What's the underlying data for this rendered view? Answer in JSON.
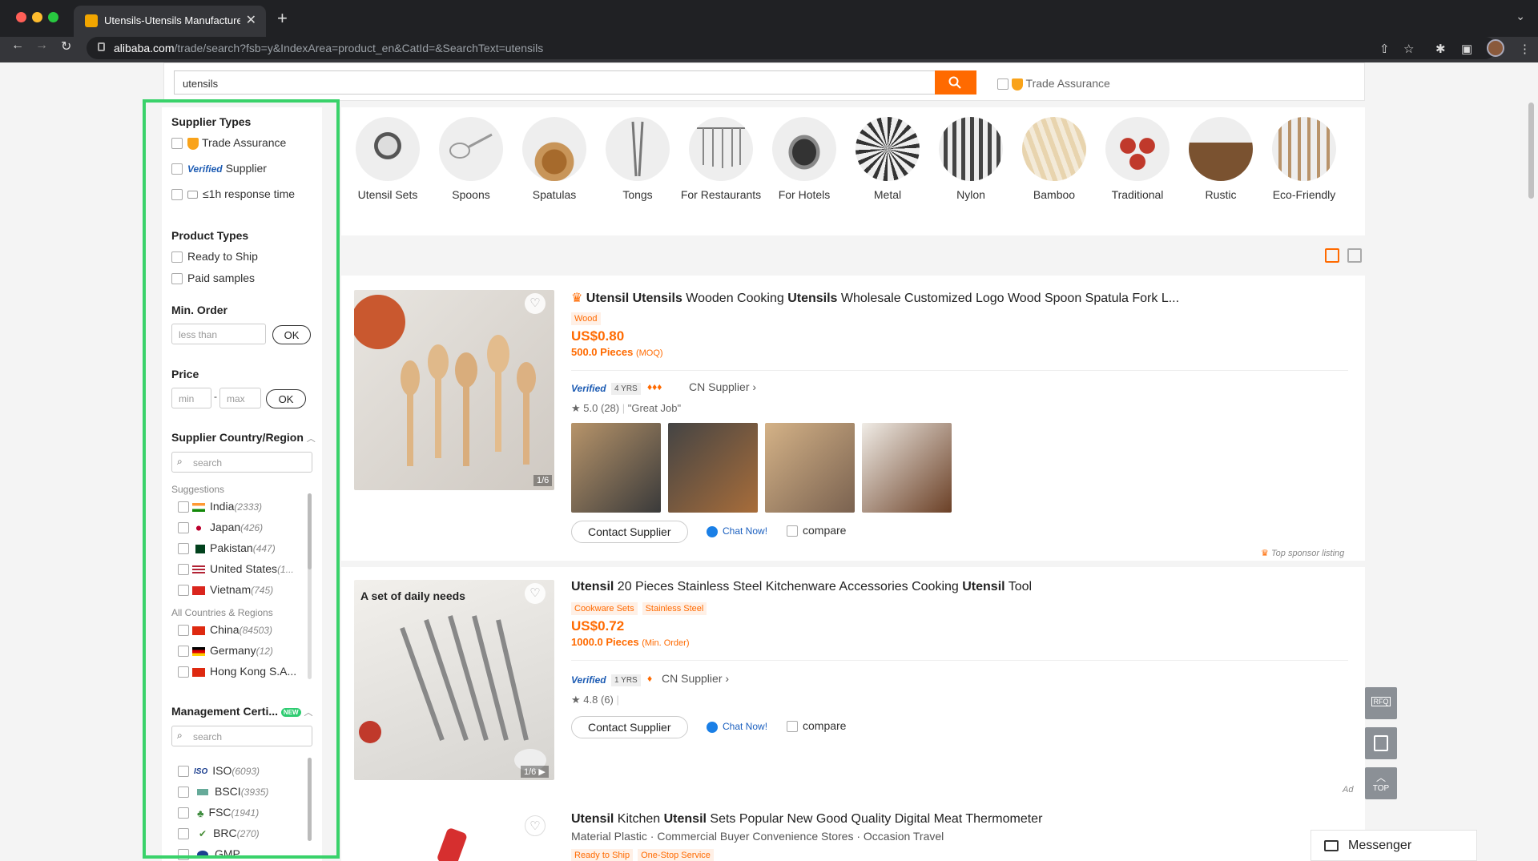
{
  "browser": {
    "tab_title": "Utensils-Utensils Manufacturer",
    "url_domain": "alibaba.com",
    "url_path": "/trade/search?fsb=y&IndexArea=product_en&CatId=&SearchText=utensils"
  },
  "search": {
    "value": "utensils",
    "trade_assurance": "Trade Assurance"
  },
  "filters": {
    "supplier_types_title": "Supplier Types",
    "trade_assurance": "Trade Assurance",
    "verified": "Verified",
    "supplier": "Supplier",
    "response_time": "≤1h response time",
    "product_types_title": "Product Types",
    "ready_to_ship": "Ready to Ship",
    "paid_samples": "Paid samples",
    "min_order_title": "Min. Order",
    "min_order_placeholder": "less than",
    "ok": "OK",
    "price_title": "Price",
    "price_min_placeholder": "min",
    "price_dash": "-",
    "price_max_placeholder": "max",
    "country_title": "Supplier Country/Region",
    "country_search_placeholder": "search",
    "suggestions_label": "Suggestions",
    "all_countries_label": "All Countries & Regions",
    "suggestions": [
      {
        "name": "India",
        "count": "(2333)"
      },
      {
        "name": "Japan",
        "count": "(426)"
      },
      {
        "name": "Pakistan",
        "count": "(447)"
      },
      {
        "name": "United States",
        "count": "(1..."
      },
      {
        "name": "Vietnam",
        "count": "(745)"
      }
    ],
    "countries": [
      {
        "name": "China",
        "count": "(84503)"
      },
      {
        "name": "Germany",
        "count": "(12)"
      },
      {
        "name": "Hong Kong S.A...",
        "count": ""
      }
    ],
    "cert_title": "Management Certi...",
    "cert_new_badge": "NEW",
    "cert_search_placeholder": "search",
    "certs": [
      {
        "name": "ISO",
        "count": "(6093)"
      },
      {
        "name": "BSCI",
        "count": "(3935)"
      },
      {
        "name": "FSC",
        "count": "(1941)"
      },
      {
        "name": "BRC",
        "count": "(270)"
      },
      {
        "name": "GMP",
        "count": ""
      }
    ]
  },
  "categories": [
    "Utensil Sets",
    "Spoons",
    "Spatulas",
    "Tongs",
    "For Restaurants",
    "For Hotels",
    "Metal",
    "Nylon",
    "Bamboo",
    "Traditional",
    "Rustic",
    "Eco-Friendly"
  ],
  "products": [
    {
      "title_parts": [
        "Utensil",
        " ",
        "Utensils",
        " Wooden Cooking ",
        "Utensils",
        " Wholesale Customized Logo Wood Spoon Spatula Fork L..."
      ],
      "tags": [
        "Wood"
      ],
      "price": "US$0.80",
      "moq_value": "500.0 Pieces",
      "moq_label": "(MOQ)",
      "verified": "Verified",
      "years": "4 YRS",
      "supplier_country": "CN Supplier",
      "rating": "5.0",
      "reviews": "(28)",
      "review_quote": "\"Great Job\"",
      "image_count": "1/6",
      "contact": "Contact Supplier",
      "chat": "Chat Now!",
      "compare": "compare",
      "sponsor": "Top sponsor listing"
    },
    {
      "title_parts": [
        "Utensil",
        " 20 Pieces Stainless Steel Kitchenware Accessories Cooking ",
        "Utensil",
        " Tool"
      ],
      "tags": [
        "Cookware Sets",
        "Stainless Steel"
      ],
      "price": "US$0.72",
      "moq_value": "1000.0 Pieces",
      "moq_label": "(Min. Order)",
      "verified": "Verified",
      "years": "1 YRS",
      "supplier_country": "CN Supplier",
      "rating": "4.8",
      "reviews": "(6)",
      "image_caption": "A set of daily needs",
      "image_count": "1/6",
      "contact": "Contact Supplier",
      "chat": "Chat Now!",
      "compare": "compare",
      "ad": "Ad"
    },
    {
      "title_parts": [
        "Utensil",
        " Kitchen ",
        "Utensil",
        " Sets Popular New Good Quality Digital Meat Thermometer"
      ],
      "meta": "Material Plastic · Commercial Buyer Convenience Stores · Occasion Travel",
      "tags": [
        "Ready to Ship",
        "One-Stop Service"
      ]
    }
  ],
  "floating": {
    "rfq": "RFQ",
    "top": "TOP",
    "messenger": "Messenger"
  },
  "colors": {
    "accent": "#ff6a00",
    "highlight_border": "#39d26a"
  }
}
